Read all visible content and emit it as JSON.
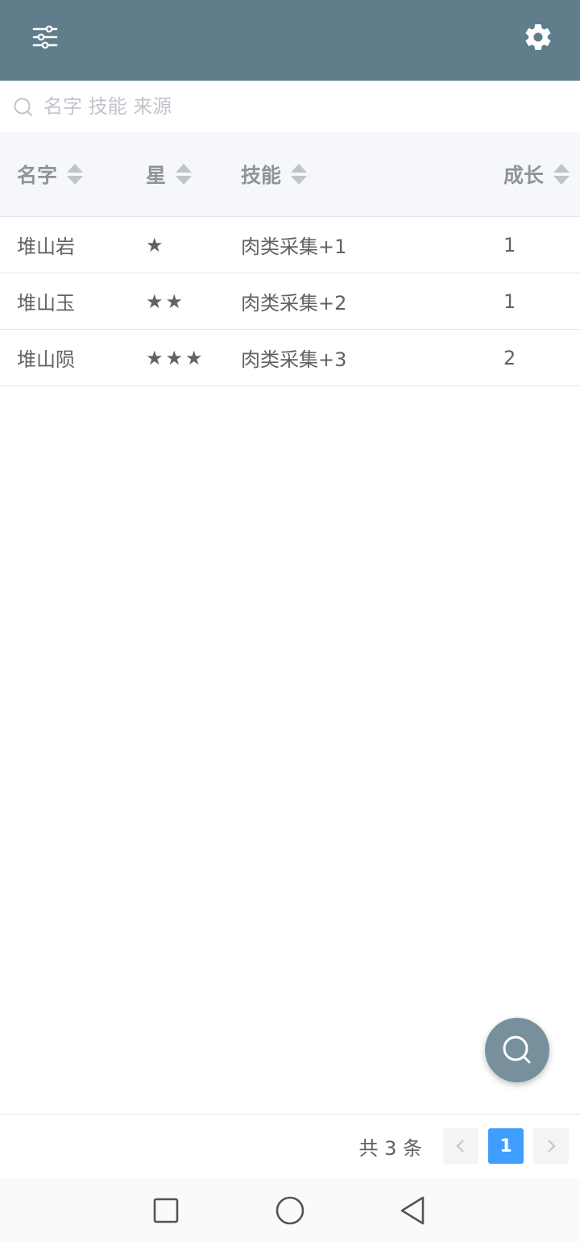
{
  "header": {
    "filter_icon": "sliders-icon",
    "settings_icon": "gear-icon",
    "background_color": "#607d8b"
  },
  "search": {
    "placeholder": "名字 技能 来源",
    "value": "",
    "icon": "search-icon"
  },
  "table": {
    "columns": [
      "名字",
      "星",
      "技能",
      "成长"
    ],
    "rows": [
      {
        "name": "堆山岩",
        "stars": "★",
        "skill": "肉类采集+1",
        "growth": "1"
      },
      {
        "name": "堆山玉",
        "stars": "★★",
        "skill": "肉类采集+2",
        "growth": "1"
      },
      {
        "name": "堆山陨",
        "stars": "★★★",
        "skill": "肉类采集+3",
        "growth": "2"
      }
    ]
  },
  "fab": {
    "icon": "search-icon",
    "color": "#78909c"
  },
  "pagination": {
    "total_text": "共 3 条",
    "current_page": "1",
    "prev_icon": "chevron-left-icon",
    "next_icon": "chevron-right-icon",
    "accent_color": "#409eff"
  },
  "system_nav": {
    "recent_icon": "square-icon",
    "home_icon": "circle-icon",
    "back_icon": "triangle-back-icon"
  }
}
